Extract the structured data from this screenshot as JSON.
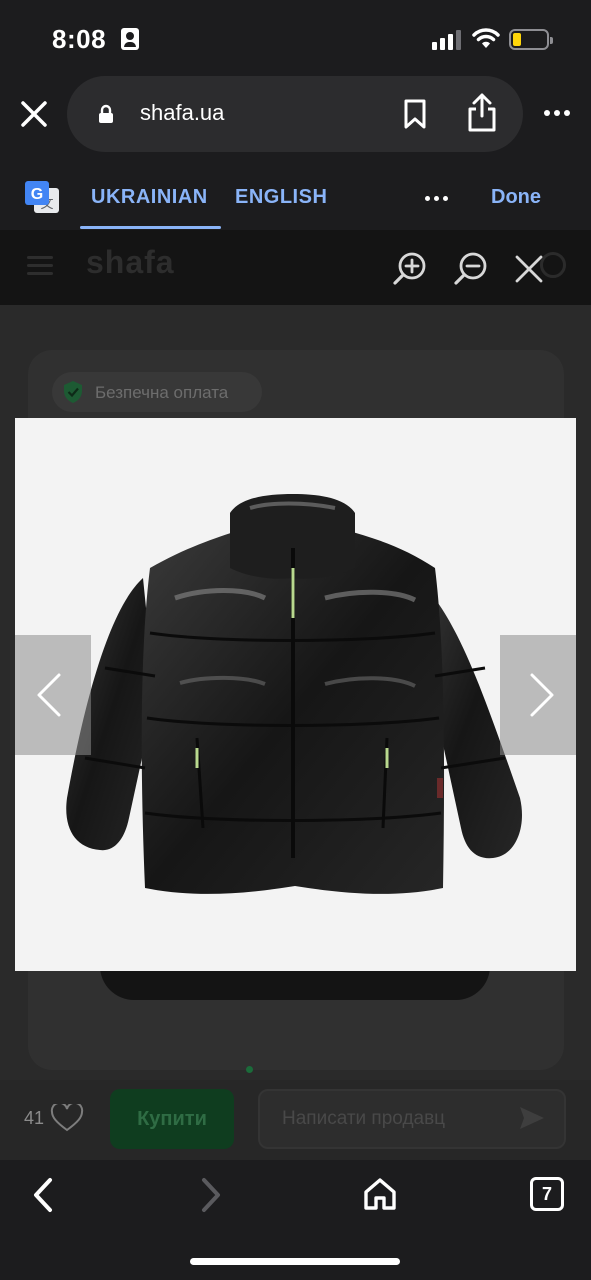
{
  "status_bar": {
    "time": "8:08",
    "icons": [
      "person-badge-icon",
      "signal-icon",
      "wifi-icon",
      "battery-icon"
    ],
    "battery_color": "#ffd60a"
  },
  "browser": {
    "url": "shafa.ua",
    "icons": [
      "close-icon",
      "lock-icon",
      "bookmark-icon",
      "share-icon",
      "more-icon"
    ]
  },
  "translate_bar": {
    "tab_source": "UKRAINIAN",
    "tab_target": "ENGLISH",
    "done_label": "Done",
    "accent_color": "#8ab4f8"
  },
  "page": {
    "logo": "shafa",
    "safe_payment": "Безпечна оплата",
    "likes_count": "41",
    "buy_label": "Купити",
    "message_placeholder": "Написати продавц"
  },
  "toolbar": {
    "tabs_count": "7",
    "icons": [
      "back-icon",
      "forward-icon",
      "home-icon",
      "tabs-icon"
    ]
  },
  "photo": {
    "subject": "black puffer jacket",
    "icons": [
      "zoom-in-icon",
      "zoom-out-icon",
      "close-viewer-icon",
      "chevron-left-icon",
      "chevron-right-icon"
    ]
  }
}
